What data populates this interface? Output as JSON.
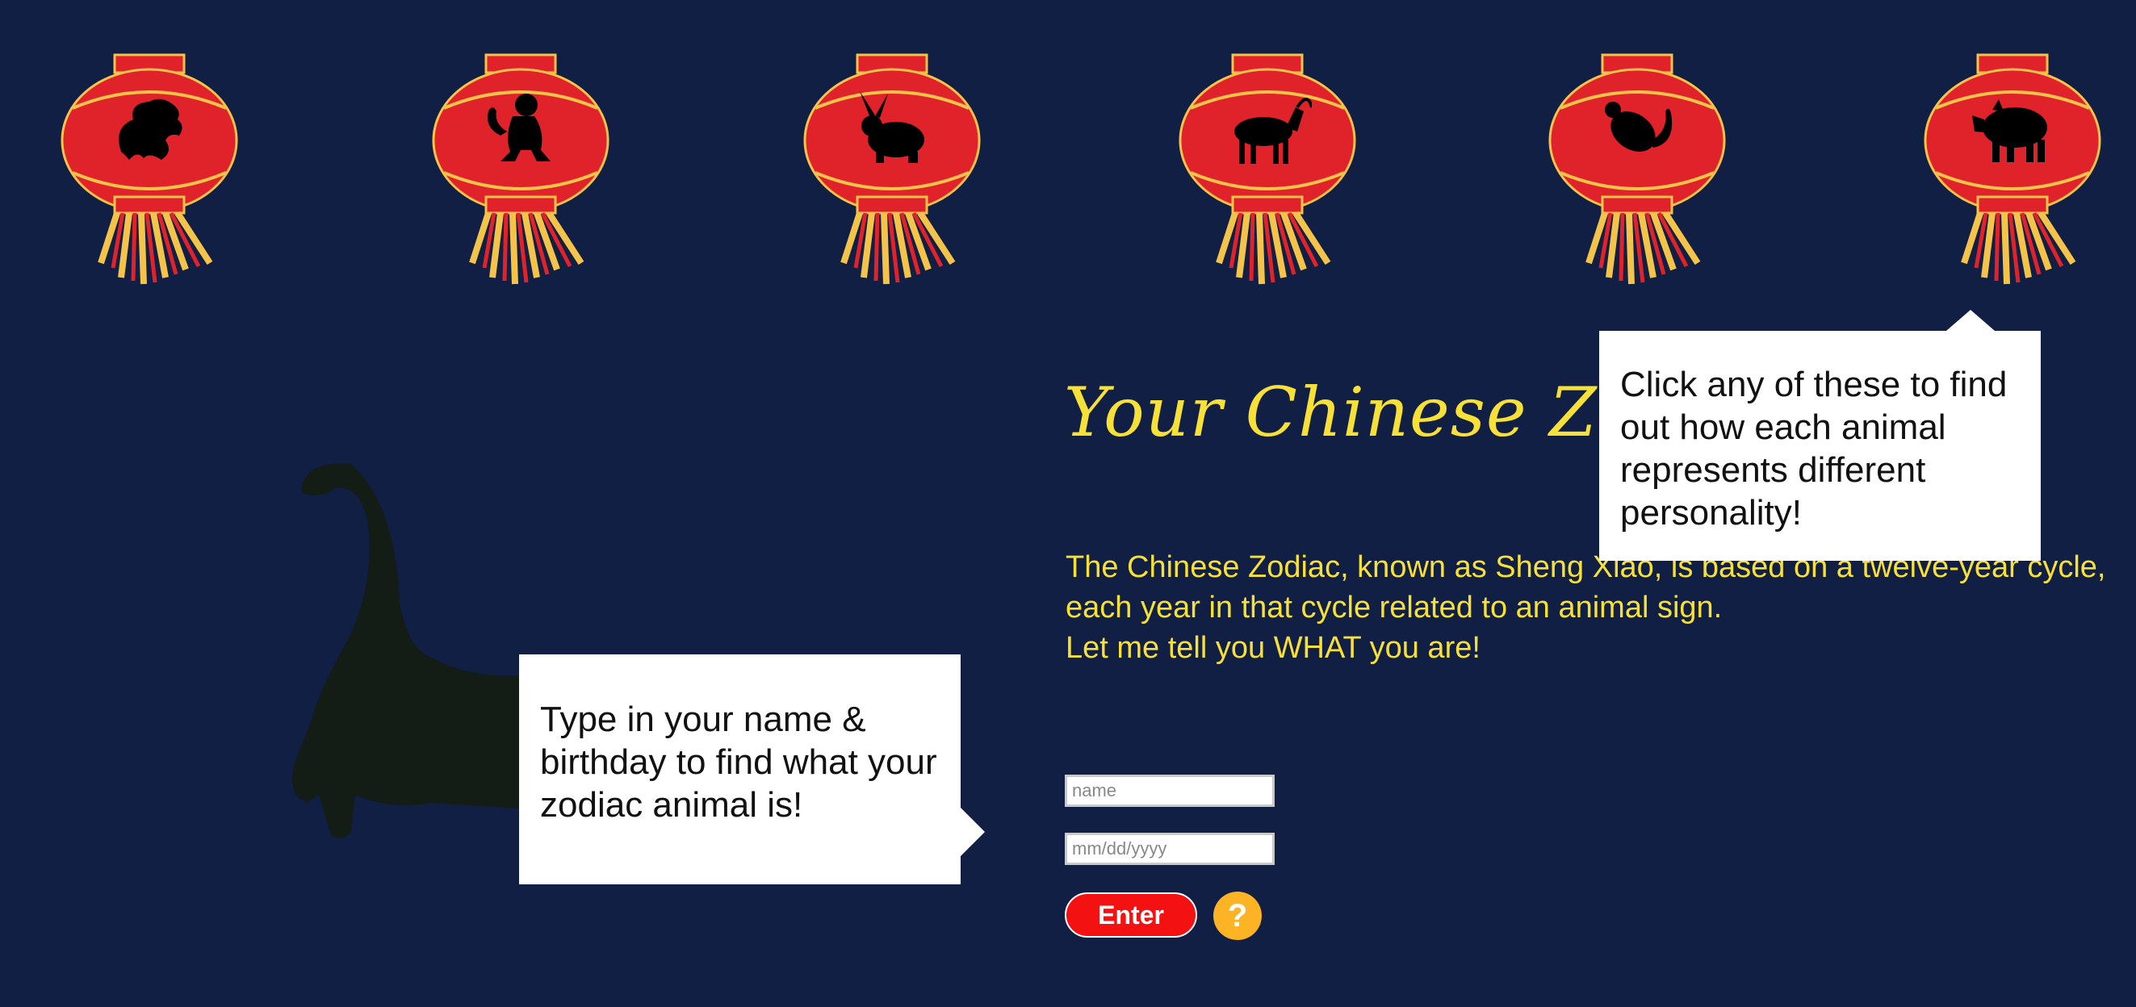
{
  "page": {
    "title": "Your Chinese Zodiac",
    "intro_lines": [
      "The Chinese Zodiac, known as Sheng Xiao, is based on a twelve-year cycle, each year in that cycle related to an animal sign.",
      "Let me tell you WHAT you are!"
    ]
  },
  "lanterns": [
    {
      "animal": "dragon",
      "icon": "dragon-icon"
    },
    {
      "animal": "monkey",
      "icon": "monkey-icon"
    },
    {
      "animal": "rabbit",
      "icon": "rabbit-icon"
    },
    {
      "animal": "goat",
      "icon": "goat-icon"
    },
    {
      "animal": "rat",
      "icon": "rat-icon"
    },
    {
      "animal": "pig",
      "icon": "pig-icon"
    }
  ],
  "tooltips": {
    "lanterns": "Click any of these to find out how each animal represents different personality!",
    "form": "Type in your name & birthday to find what your zodiac animal is!"
  },
  "form": {
    "name_placeholder": "name",
    "date_placeholder": "mm/dd/yyyy",
    "enter_label": "Enter",
    "help_label": "?"
  },
  "colors": {
    "background": "#111f44",
    "accent_yellow": "#f7e037",
    "lantern_red": "#e0232b",
    "lantern_gold": "#f4c34a",
    "enter_red": "#f41111",
    "help_orange": "#fcb424"
  }
}
